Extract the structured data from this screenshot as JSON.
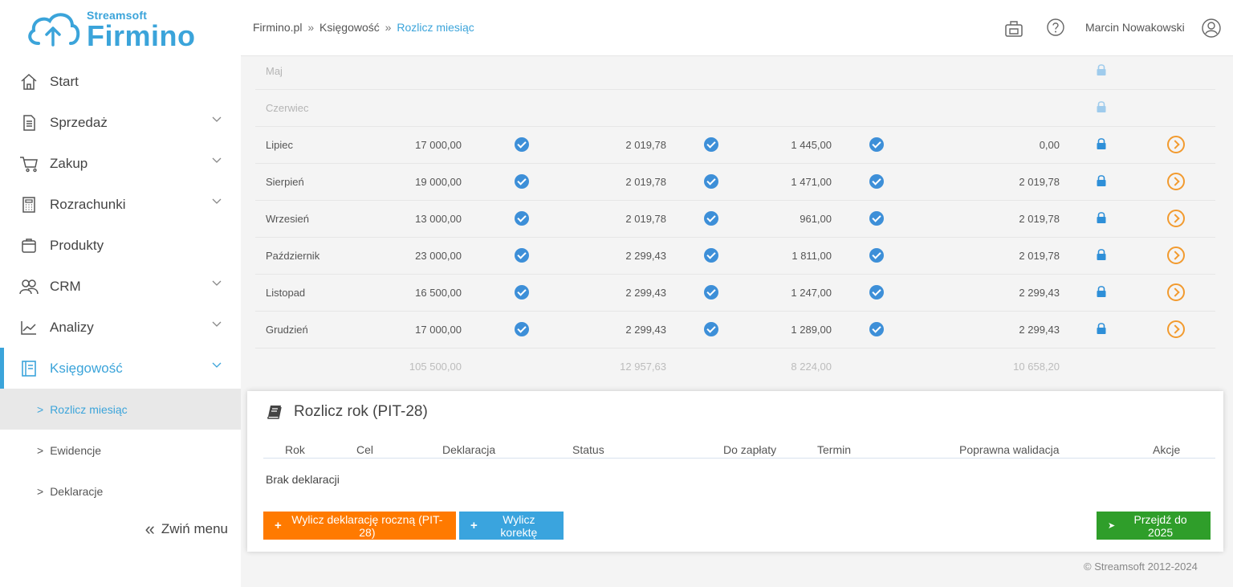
{
  "logo": {
    "top": "Streamsoft",
    "main": "Firmino"
  },
  "header": {
    "breadcrumb": [
      "Firmino.pl",
      "Księgowość",
      "Rozlicz miesiąc"
    ],
    "separator": "»",
    "user": "Marcin Nowakowski"
  },
  "sidebar": {
    "items": [
      {
        "label": "Start",
        "icon": "home-icon"
      },
      {
        "label": "Sprzedaż",
        "icon": "document-icon"
      },
      {
        "label": "Zakup",
        "icon": "cart-icon"
      },
      {
        "label": "Rozrachunki",
        "icon": "calculator-icon"
      },
      {
        "label": "Produkty",
        "icon": "box-icon"
      },
      {
        "label": "CRM",
        "icon": "users-icon"
      },
      {
        "label": "Analizy",
        "icon": "chart-icon"
      },
      {
        "label": "Księgowość",
        "icon": "book-icon"
      }
    ],
    "subitems": [
      "Rozlicz miesiąc",
      "Ewidencje",
      "Deklaracje"
    ],
    "collapse_label": "Zwiń menu",
    "accent": "#3ba4da"
  },
  "months": [
    {
      "name": "Maj",
      "v1": "",
      "v2": "",
      "v3": "",
      "v4": ""
    },
    {
      "name": "Czerwiec",
      "v1": "",
      "v2": "",
      "v3": "",
      "v4": ""
    },
    {
      "name": "Lipiec",
      "v1": "17 000,00",
      "v2": "2 019,78",
      "v3": "1 445,00",
      "v4": "0,00"
    },
    {
      "name": "Sierpień",
      "v1": "19 000,00",
      "v2": "2 019,78",
      "v3": "1 471,00",
      "v4": "2 019,78"
    },
    {
      "name": "Wrzesień",
      "v1": "13 000,00",
      "v2": "2 019,78",
      "v3": "961,00",
      "v4": "2 019,78"
    },
    {
      "name": "Październik",
      "v1": "23 000,00",
      "v2": "2 299,43",
      "v3": "1 811,00",
      "v4": "2 019,78"
    },
    {
      "name": "Listopad",
      "v1": "16 500,00",
      "v2": "2 299,43",
      "v3": "1 247,00",
      "v4": "2 299,43"
    },
    {
      "name": "Grudzień",
      "v1": "17 000,00",
      "v2": "2 299,43",
      "v3": "1 289,00",
      "v4": "2 299,43"
    }
  ],
  "totals": {
    "t1": "105 500,00",
    "t2": "12 957,63",
    "t3": "8 224,00",
    "t4": "10 658,20"
  },
  "panel": {
    "title": "Rozlicz rok (PIT-28)",
    "columns": [
      "Rok",
      "Cel",
      "Deklaracja",
      "Status",
      "Do zapłaty",
      "Termin",
      "Poprawna walidacja",
      "Akcje"
    ],
    "empty": "Brak deklaracji",
    "btn_calc": "Wylicz deklarację roczną (PIT-28)",
    "btn_correction": "Wylicz korektę",
    "btn_next": "Przejdź do 2025",
    "colors": {
      "orange": "#ff7a00",
      "blue": "#3aa4de",
      "green": "#2f9e2a"
    }
  },
  "footer": "© Streamsoft 2012-2024"
}
